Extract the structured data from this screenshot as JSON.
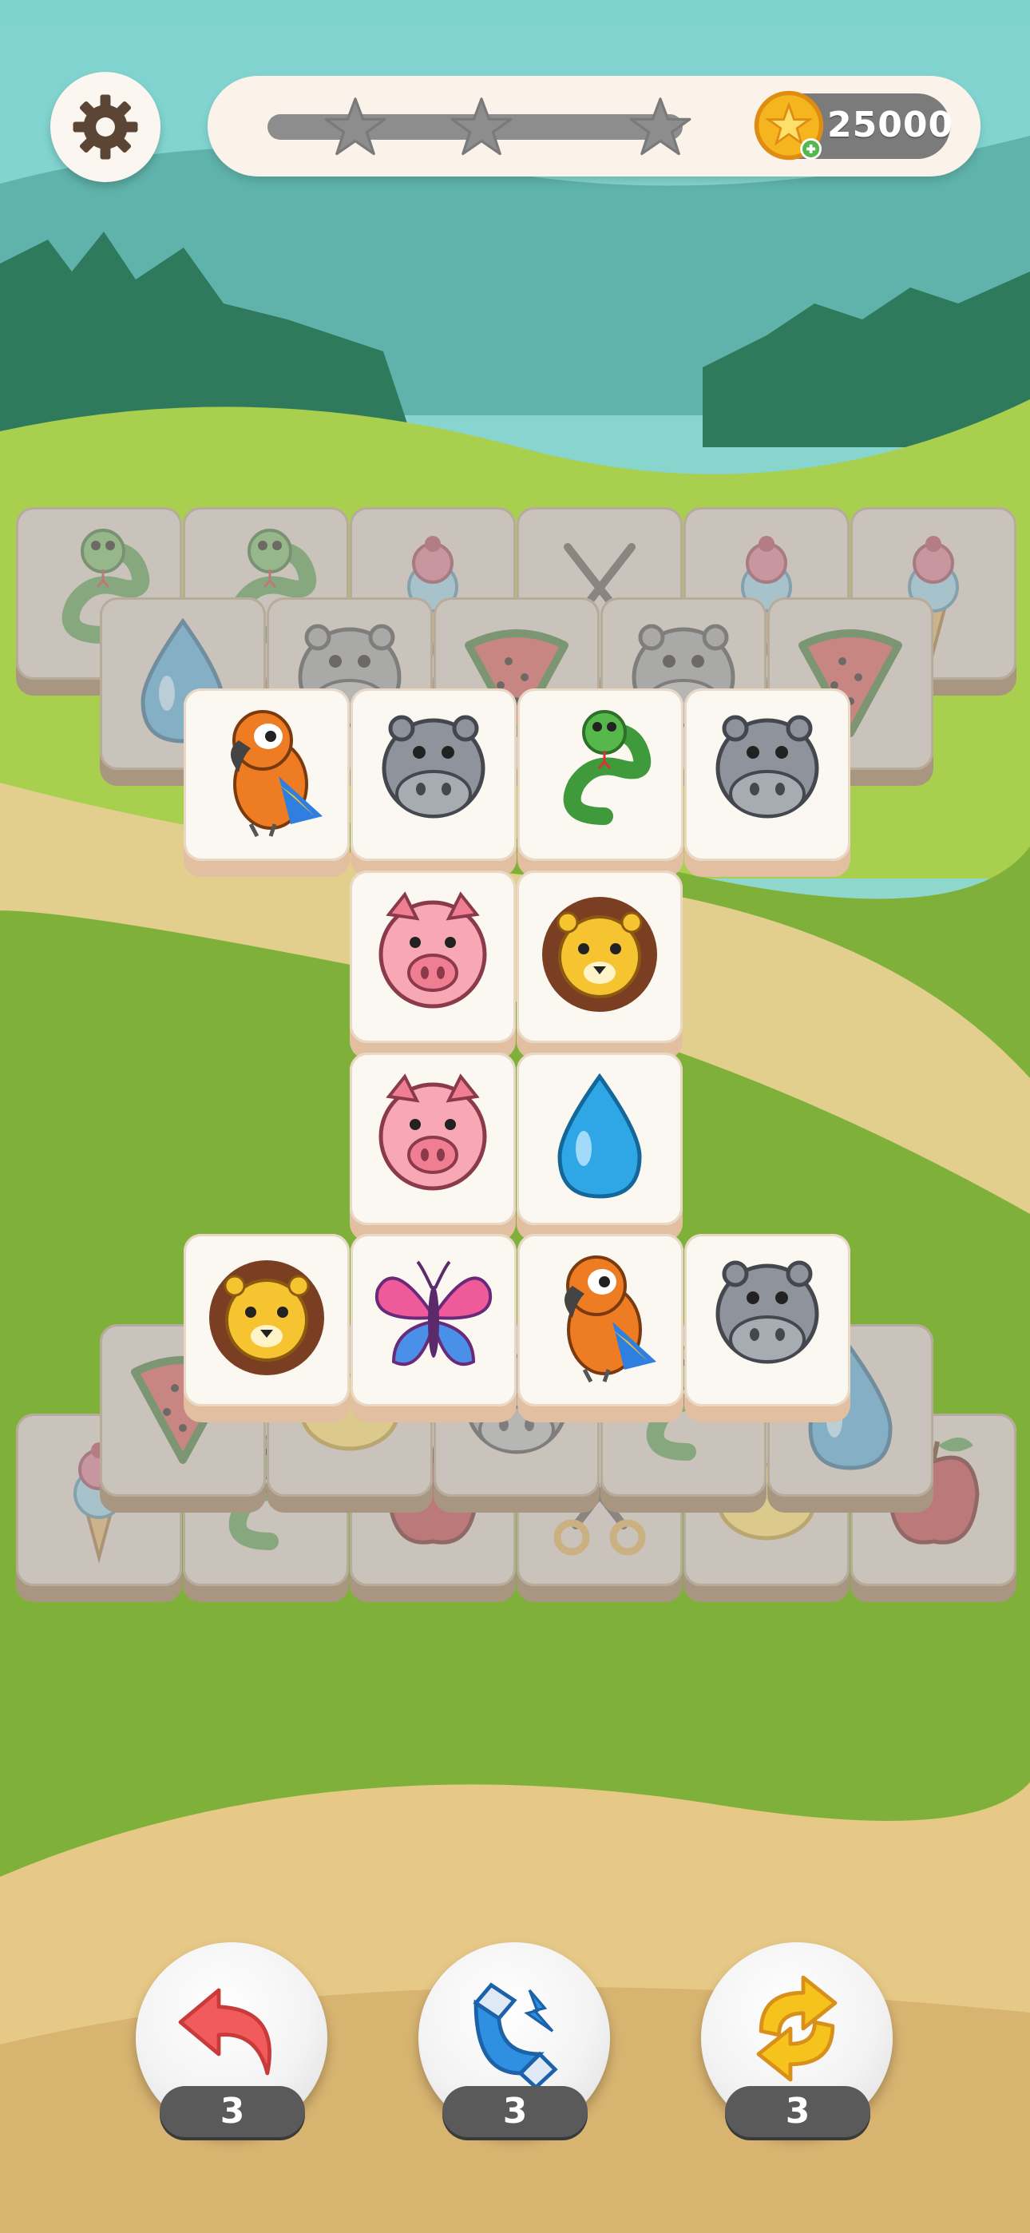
{
  "hud": {
    "coins": "25000",
    "progress_stars_filled": 0,
    "progress_stars_total": 3
  },
  "icons": {
    "settings": "gear-icon",
    "coin": "coin-icon",
    "undo": "undo-arrow-icon",
    "magnet": "magnet-icon",
    "shuffle": "shuffle-icon"
  },
  "boosters": [
    {
      "name": "undo",
      "count": "3"
    },
    {
      "name": "magnet",
      "count": "3"
    },
    {
      "name": "shuffle",
      "count": "3"
    }
  ],
  "tiles": {
    "layer_back_top_row": [
      "snake",
      "snake",
      "ice-cream",
      "scissors",
      "ice-cream",
      "ice-cream"
    ],
    "layer_mid_top_row": [
      "water-drop",
      "hippo",
      "watermelon",
      "hippo",
      "watermelon"
    ],
    "front_rows": [
      [
        "parrot",
        "hippo",
        "snake",
        "hippo"
      ],
      [
        "pig",
        "lion"
      ],
      [
        "pig",
        "water-drop"
      ],
      [
        "lion",
        "butterfly",
        "parrot",
        "hippo"
      ]
    ],
    "layer_mid_bottom_row": [
      "watermelon",
      "lemon",
      "hippo",
      "snake",
      "water-drop"
    ],
    "layer_back_bottom_row": [
      "ice-cream",
      "snake",
      "apple",
      "scissors",
      "lemon",
      "apple"
    ]
  },
  "colors": {
    "tile_face": "#fbf7f1",
    "tile_edge": "#e2bfa0",
    "coin_gold": "#f5b51e",
    "counter_bg": "#5a5a5a"
  }
}
